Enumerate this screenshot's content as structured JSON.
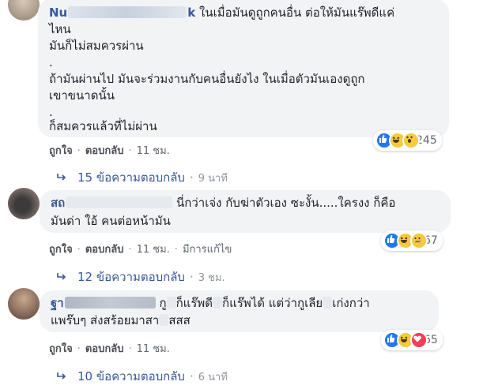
{
  "comments": [
    {
      "author_visible": "Nu",
      "author_suffix": "k",
      "lines": [
        "ในเมื่อมันดูถูกคนอื่น ต่อให้มันแร๊พดีแค่",
        "ไหน",
        "มันก็ไม่สมควรผ่าน",
        ".",
        "ถ้ามันผ่านไป มันจะร่วมงานกับคนอื่นยังไง ในเมื่อตัวมันเองดูถูก",
        "เขาขนาดนั้น",
        ".",
        "ก็สมควรแล้วที่ไม่ผ่าน"
      ],
      "actions": {
        "like": "ถูกใจ",
        "reply": "ตอบกลับ",
        "time": "11 ชม."
      },
      "reactions": {
        "types": [
          "like",
          "haha",
          "wow"
        ],
        "count": "245"
      },
      "replies": {
        "label": "15 ข้อความตอบกลับ",
        "time": "9 นาที"
      }
    },
    {
      "author_visible": "สถ",
      "author_suffix": "",
      "lines": [
        "นี่กว่าเจ่ง กับฆ่าตัวเอง ซะงั้น.....ใครงง ก็คือ",
        "มันด่า ใอ้ คนต่อหน้ามัน"
      ],
      "actions": {
        "like": "ถูกใจ",
        "reply": "ตอบกลับ",
        "time": "11 ชม.",
        "edited": "มีการแก้ไข"
      },
      "reactions": {
        "types": [
          "like",
          "haha",
          "sad"
        ],
        "count": "67"
      },
      "replies": {
        "label": "12 ข้อความตอบกลับ",
        "time": "3 ชม."
      }
    },
    {
      "author_visible": "ฐา",
      "author_suffix": "",
      "lines_parts": {
        "l1_a": "กู",
        "l1_b": "ก็แร๊พดี",
        "l1_c": "ก็แร๊พได้ แต่ว่ากูเลีย",
        "l1_d": "เก่งกว่า",
        "l2_a": "แพร๊บๆ ส่งสร้อยมาสา",
        "l2_b": "สสส"
      },
      "actions": {
        "like": "ถูกใจ",
        "reply": "ตอบกลับ",
        "time": "11 ชม."
      },
      "reactions": {
        "types": [
          "like",
          "haha",
          "love"
        ],
        "count": "65"
      },
      "replies": {
        "label": "10 ข้อความตอบกลับ",
        "time": "6 นาที"
      }
    }
  ],
  "colors": {
    "link": "#385898",
    "bubble": "#f2f3f5",
    "meta": "#616770"
  }
}
